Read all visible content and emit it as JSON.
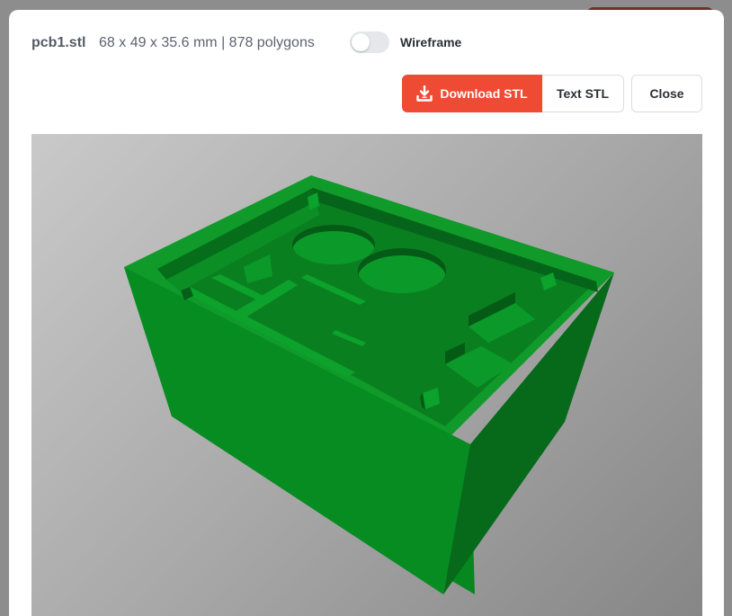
{
  "header": {
    "filename": "pcb1.stl",
    "meta": "68 x 49 x 35.6 mm | 878 polygons",
    "wireframe_label": "Wireframe",
    "wireframe_on": false
  },
  "actions": {
    "download_label": "Download STL",
    "text_label": "Text STL",
    "close_label": "Close"
  },
  "icons": {
    "download": "download-icon"
  },
  "colors": {
    "accent": "#ef4a33",
    "model_green": "#0a8a22"
  }
}
